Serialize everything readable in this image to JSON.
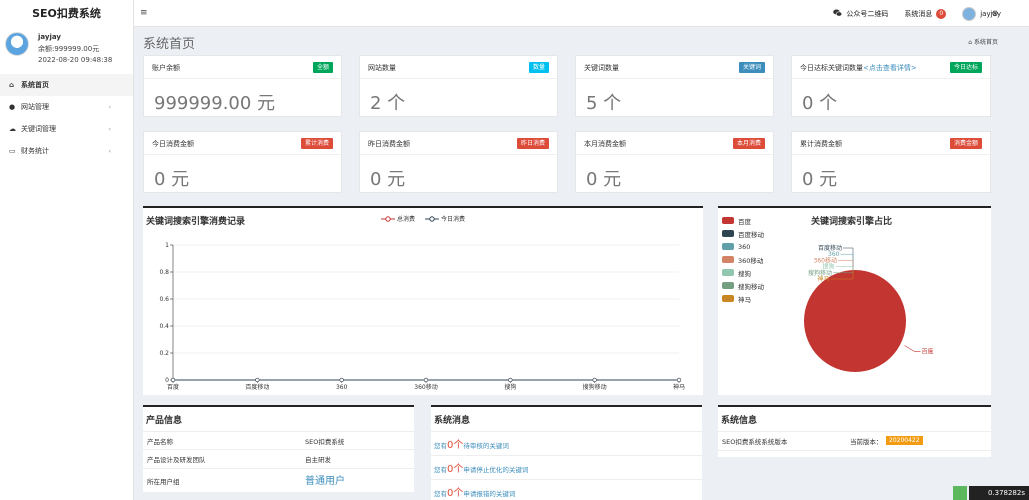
{
  "app": {
    "title": "SEO扣费系统",
    "menu_toggle": "≡"
  },
  "topnav": {
    "wechat": "公众号二维码",
    "messages": "系统消息",
    "msg_count": "0",
    "username": "jayjay"
  },
  "user": {
    "name": "jayjay",
    "balance": "余额:999999.00元",
    "date": "2022-08-20 09:48:38"
  },
  "sidebar": {
    "items": [
      {
        "label": "系统首页",
        "icon": "home-icon"
      },
      {
        "label": "网站管理",
        "icon": "circle-icon"
      },
      {
        "label": "关键词管理",
        "icon": "cloud-icon"
      },
      {
        "label": "财务统计",
        "icon": "card-icon"
      }
    ]
  },
  "page": {
    "title": "系统首页",
    "breadcrumb": "系统首页"
  },
  "stats": [
    {
      "label": "账户余额",
      "tag": "全额",
      "tag_color": "#00a65a",
      "value": "999999.00 元"
    },
    {
      "label": "网站数量",
      "tag": "数量",
      "tag_color": "#00c0ef",
      "value": "2 个"
    },
    {
      "label": "关键词数量",
      "tag": "关键词",
      "tag_color": "#3c8dbc",
      "value": "5 个"
    },
    {
      "label": "今日达标关键词数量",
      "hint": "<点击查看详情>",
      "tag": "今日达标",
      "tag_color": "#00a65a",
      "value": "0 个"
    },
    {
      "label": "今日消费金额",
      "tag": "累计消费",
      "tag_color": "#dd4b39",
      "value": "0 元"
    },
    {
      "label": "昨日消费金额",
      "tag": "昨日消费",
      "tag_color": "#dd4b39",
      "value": "0 元"
    },
    {
      "label": "本月消费金额",
      "tag": "本月消费",
      "tag_color": "#dd4b39",
      "value": "0 元"
    },
    {
      "label": "累计消费金额",
      "tag": "消费金额",
      "tag_color": "#dd4b39",
      "value": "0 元"
    }
  ],
  "line_panel": {
    "title": "关键词搜索引擎消费记录"
  },
  "pie_panel": {
    "title": "关键词搜索引擎占比"
  },
  "chart_data": [
    {
      "type": "line",
      "categories": [
        "百度",
        "百度移动",
        "360",
        "360移动",
        "搜狗",
        "搜狗移动",
        "神马"
      ],
      "series": [
        {
          "name": "总消费",
          "color": "#c23531",
          "values": [
            0,
            0,
            0,
            0,
            0,
            0,
            0
          ]
        },
        {
          "name": "今日消费",
          "color": "#2f4554",
          "values": [
            0,
            0,
            0,
            0,
            0,
            0,
            0
          ]
        }
      ],
      "ylim": [
        0,
        1
      ],
      "yticks": [
        "0",
        "0.2",
        "0.4",
        "0.6",
        "0.8",
        "1"
      ],
      "grid": true,
      "legend": "top-center"
    },
    {
      "type": "pie",
      "labels": [
        "百度",
        "百度移动",
        "360",
        "360移动",
        "搜狗",
        "搜狗移动",
        "神马"
      ],
      "colors": [
        "#c23531",
        "#2f4554",
        "#61a0a8",
        "#d48265",
        "#91c7ae",
        "#749f83",
        "#ca8622"
      ],
      "values": [
        100,
        0,
        0,
        0,
        0,
        0,
        0
      ],
      "legend": "left"
    }
  ],
  "product": {
    "title": "产品信息",
    "rows": [
      {
        "k": "产品名称",
        "v": "SEO扣费系统"
      },
      {
        "k": "产品设计及研发团队",
        "v": "自主研发"
      },
      {
        "k": "所在用户组",
        "v": "普通用户"
      }
    ]
  },
  "sysmsg": {
    "title": "系统消息",
    "items": [
      {
        "pre": "您有",
        "num": "0个",
        "post": "待审核的关键词"
      },
      {
        "pre": "您有",
        "num": "0个",
        "post": "申请停止优化的关键词"
      },
      {
        "pre": "您有",
        "num": "0个",
        "post": "申请报错的关键词"
      }
    ]
  },
  "sysinfo": {
    "title": "系统信息",
    "label": "SEO扣费系统系统版本",
    "cur": "当前版本：",
    "version": "20200422"
  },
  "watermark": "0.378282s"
}
